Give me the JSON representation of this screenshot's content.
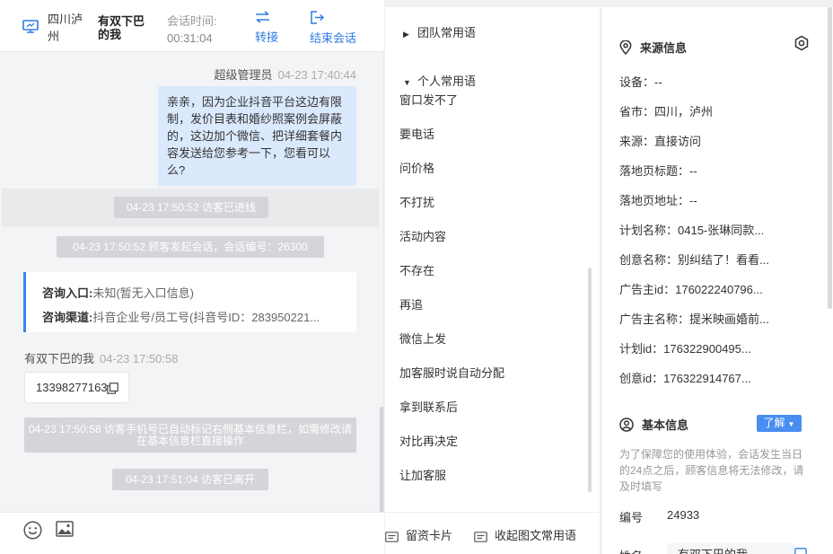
{
  "chat": {
    "header": {
      "region": "四川泸州",
      "visitor_name": "有双下巴的我",
      "session_time_label": "会话时间:",
      "session_time": "00:31:04",
      "transfer_label": "转接",
      "end_label": "结束会话"
    },
    "messages": {
      "agent_name": "超级管理员",
      "agent_ts": "04-23 17:40:44",
      "agent_text": "亲亲，因为企业抖音平台这边有限制，发价目表和婚纱照案例会屏蔽的，这边加个微信、把详细套餐内容发送给您参考一下，您看可以么?",
      "sys_entered": "04-23 17:50:52 访客已进线",
      "sys_session": "04-23 17:50:52 顾客发起会话，会话编号：26300",
      "entry_label": "咨询入口:",
      "entry_value": "未知(暂无入口信息)",
      "channel_label": "咨询渠道:",
      "channel_value": "抖音企业号/员工号(抖音号ID：283950221...",
      "visitor_name": "有双下巴的我",
      "visitor_ts": "04-23 17:50:58",
      "visitor_phone": "13398277163",
      "sys_phone_marked": "04-23 17:50:58 访客手机号已自动标记右侧基本信息栏，如需修改请在基本信息栏直接操作",
      "sys_left": "04-23 17:51:04 访客已离开"
    }
  },
  "phrases": {
    "team_group": "团队常用语",
    "personal_group": "个人常用语",
    "items": [
      "窗口发不了",
      "要电话",
      "问价格",
      "不打扰",
      "活动内容",
      "不存在",
      "再追",
      "微信上发",
      "加客服时说自动分配",
      "拿到联系后",
      "对比再决定",
      "让加客服"
    ],
    "footer": {
      "card_label": "留资卡片",
      "collapse_label": "收起图文常用语"
    }
  },
  "info": {
    "source_title": "来源信息",
    "rows": [
      "设备：--",
      "省市：四川，泸州",
      "来源：直接访问",
      "落地页标题：--",
      "落地页地址：--",
      "计划名称：0415-张琳同款...",
      "创意名称：别纠结了！看看...",
      "广告主id：176022240796...",
      "广告主名称：提米映画婚前...",
      "计划id：176322900495...",
      "创意id：176322914767..."
    ],
    "basic_title": "基本信息",
    "learn_label": "了解",
    "notice": "为了保障您的使用体验，会话发生当日的24点之后，顾客信息将无法修改，请及时填写",
    "id_label": "编号",
    "id_value": "24933",
    "name_label": "姓名",
    "name_value": "有双下巴的我"
  },
  "colors": {
    "accent": "#2e7be6",
    "agent_bubble": "#dbe9fd",
    "system_pill": "#d3d5d8"
  },
  "icons": {
    "monitor": "monitor-icon",
    "transfer": "transfer-icon",
    "end": "exit-icon",
    "copy": "copy-icon",
    "emoji": "smiley-icon",
    "image": "image-icon",
    "location": "location-pin-icon",
    "settings": "hexagon-settings-icon",
    "user": "user-circle-icon",
    "card": "card-icon",
    "caret": "caret-down-icon"
  }
}
